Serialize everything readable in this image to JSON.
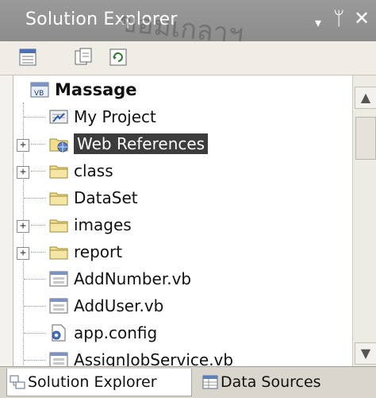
{
  "window": {
    "title": "Solution Explorer",
    "watermark": "ขอมเกลาฯ",
    "dropdown_glyph": "▾",
    "pin_glyph": "ᛘ",
    "close_glyph": "✕"
  },
  "toolbar": {
    "properties_icon": "properties-icon",
    "show_all_files_icon": "show-all-files-icon",
    "refresh_icon": "refresh-icon"
  },
  "tree": {
    "project": "Massage",
    "items": [
      {
        "label": "My Project",
        "icon": "my-project-icon",
        "expandable": false
      },
      {
        "label": "Web References",
        "icon": "web-references-folder-icon",
        "expandable": true,
        "expander": "+",
        "selected": true
      },
      {
        "label": "class",
        "icon": "folder-icon",
        "expandable": true,
        "expander": "+"
      },
      {
        "label": "DataSet",
        "icon": "folder-icon",
        "expandable": false
      },
      {
        "label": "images",
        "icon": "folder-icon",
        "expandable": true,
        "expander": "+"
      },
      {
        "label": "report",
        "icon": "folder-icon",
        "expandable": true,
        "expander": "+"
      },
      {
        "label": "AddNumber.vb",
        "icon": "vb-form-icon",
        "expandable": false
      },
      {
        "label": "AddUser.vb",
        "icon": "vb-form-icon",
        "expandable": false
      },
      {
        "label": "app.config",
        "icon": "config-file-icon",
        "expandable": false
      },
      {
        "label": "AssignJobService.vb",
        "icon": "vb-form-icon",
        "expandable": false
      }
    ]
  },
  "scrollbar": {
    "up": "▲",
    "down": "▼"
  },
  "tabs": [
    {
      "label": "Solution Explorer",
      "icon": "solution-explorer-icon",
      "active": true
    },
    {
      "label": "Data Sources",
      "icon": "data-sources-icon",
      "active": false
    }
  ],
  "colors": {
    "titlebar": "#8f8f8f",
    "selection": "#3c3c3c",
    "folder": "#f2dd8a"
  }
}
